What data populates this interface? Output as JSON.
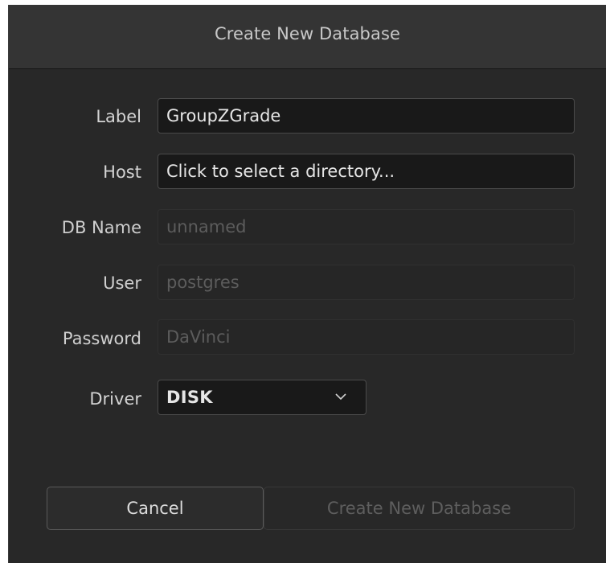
{
  "dialog": {
    "title": "Create New Database"
  },
  "form": {
    "label": {
      "label": "Label",
      "value": "GroupZGrade"
    },
    "host": {
      "label": "Host",
      "value": "Click to select a directory..."
    },
    "db_name": {
      "label": "DB Name",
      "placeholder": "unnamed"
    },
    "user": {
      "label": "User",
      "placeholder": "postgres"
    },
    "password": {
      "label": "Password",
      "placeholder": "DaVinci"
    },
    "driver": {
      "label": "Driver",
      "selected": "DISK",
      "icon": "chevron-down-icon"
    }
  },
  "buttons": {
    "cancel": "Cancel",
    "create": "Create New Database"
  },
  "colors": {
    "background": "#282828",
    "titlebar": "#343434",
    "field_bg": "#191919",
    "disabled_text": "#5c5c5c"
  }
}
